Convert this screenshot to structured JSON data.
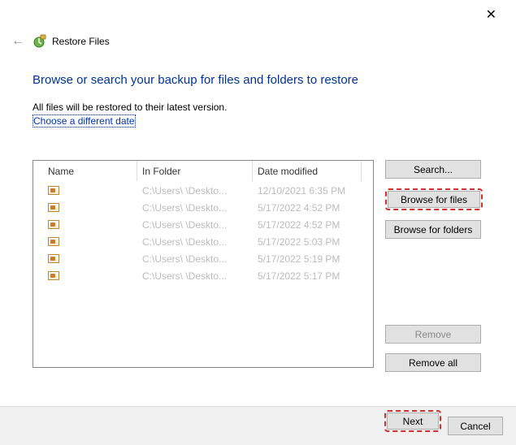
{
  "window": {
    "close": "✕",
    "back": "←",
    "title": "Restore Files"
  },
  "heading": "Browse or search your backup for files and folders to restore",
  "subtext": "All files will be restored to their latest version.",
  "choose_link": "Choose a different date",
  "columns": {
    "name": "Name",
    "folder": "In Folder",
    "date": "Date modified"
  },
  "rows": [
    {
      "folder": "C:\\Users\\        \\Deskto...",
      "date": "12/10/2021 6:35 PM"
    },
    {
      "folder": "C:\\Users\\        \\Deskto...",
      "date": "5/17/2022 4:52 PM"
    },
    {
      "folder": "C:\\Users\\        \\Deskto...",
      "date": "5/17/2022 4:52 PM"
    },
    {
      "folder": "C:\\Users\\        \\Deskto...",
      "date": "5/17/2022 5:03 PM"
    },
    {
      "folder": "C:\\Users\\        \\Deskto...",
      "date": "5/17/2022 5:19 PM"
    },
    {
      "folder": "C:\\Users\\        \\Deskto...",
      "date": "5/17/2022 5:17 PM"
    }
  ],
  "buttons": {
    "search": "Search...",
    "browse_files": "Browse for files",
    "browse_folders": "Browse for folders",
    "remove": "Remove",
    "remove_all": "Remove all",
    "next": "Next",
    "cancel": "Cancel"
  }
}
